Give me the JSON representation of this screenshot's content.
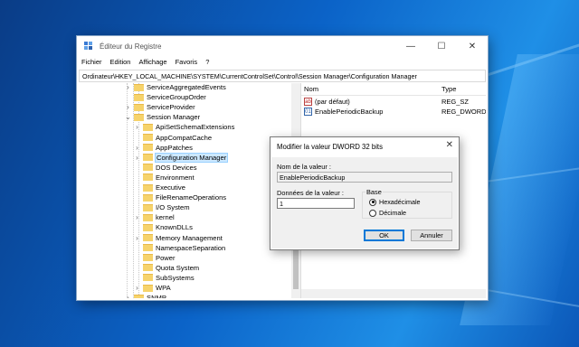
{
  "window": {
    "title": "Éditeur du Registre",
    "controls": {
      "minimize": "—",
      "maximize": "☐",
      "close": "✕"
    }
  },
  "menu": [
    "Fichier",
    "Edition",
    "Affichage",
    "Favoris",
    "?"
  ],
  "address": "Ordinateur\\HKEY_LOCAL_MACHINE\\SYSTEM\\CurrentControlSet\\Control\\Session Manager\\Configuration Manager",
  "tree": [
    {
      "label": "ServiceAggregatedEvents",
      "level": 0,
      "chevron": "›",
      "selected": false
    },
    {
      "label": "ServiceGroupOrder",
      "level": 0,
      "chevron": "",
      "selected": false
    },
    {
      "label": "ServiceProvider",
      "level": 0,
      "chevron": "›",
      "selected": false
    },
    {
      "label": "Session Manager",
      "level": 0,
      "chevron": "⌄",
      "selected": false
    },
    {
      "label": "ApiSetSchemaExtensions",
      "level": 1,
      "chevron": "›",
      "selected": false
    },
    {
      "label": "AppCompatCache",
      "level": 1,
      "chevron": "",
      "selected": false
    },
    {
      "label": "AppPatches",
      "level": 1,
      "chevron": "›",
      "selected": false
    },
    {
      "label": "Configuration Manager",
      "level": 1,
      "chevron": "›",
      "selected": true
    },
    {
      "label": "DOS Devices",
      "level": 1,
      "chevron": "",
      "selected": false
    },
    {
      "label": "Environment",
      "level": 1,
      "chevron": "",
      "selected": false
    },
    {
      "label": "Executive",
      "level": 1,
      "chevron": "",
      "selected": false
    },
    {
      "label": "FileRenameOperations",
      "level": 1,
      "chevron": "",
      "selected": false
    },
    {
      "label": "I/O System",
      "level": 1,
      "chevron": "",
      "selected": false
    },
    {
      "label": "kernel",
      "level": 1,
      "chevron": "›",
      "selected": false
    },
    {
      "label": "KnownDLLs",
      "level": 1,
      "chevron": "",
      "selected": false
    },
    {
      "label": "Memory Management",
      "level": 1,
      "chevron": "›",
      "selected": false
    },
    {
      "label": "NamespaceSeparation",
      "level": 1,
      "chevron": "",
      "selected": false
    },
    {
      "label": "Power",
      "level": 1,
      "chevron": "",
      "selected": false
    },
    {
      "label": "Quota System",
      "level": 1,
      "chevron": "",
      "selected": false
    },
    {
      "label": "SubSystems",
      "level": 1,
      "chevron": "",
      "selected": false
    },
    {
      "label": "WPA",
      "level": 1,
      "chevron": "›",
      "selected": false
    },
    {
      "label": "SNMP",
      "level": 0,
      "chevron": "›",
      "selected": false
    }
  ],
  "values_pane": {
    "columns": {
      "name": "Nom",
      "type": "Type"
    },
    "rows": [
      {
        "icon": "string-value-icon",
        "name": "(par défaut)",
        "type": "REG_SZ"
      },
      {
        "icon": "dword-value-icon",
        "name": "EnablePeriodicBackup",
        "type": "REG_DWORD"
      }
    ]
  },
  "dialog": {
    "title": "Modifier la valeur DWORD 32 bits",
    "close": "✕",
    "name_label": "Nom de la valeur :",
    "name_value": "EnablePeriodicBackup",
    "data_label": "Données de la valeur :",
    "data_value": "1",
    "base_label": "Base",
    "base_options": [
      {
        "label": "Hexadécimale",
        "checked": true
      },
      {
        "label": "Décimale",
        "checked": false
      }
    ],
    "ok": "OK",
    "cancel": "Annuler"
  }
}
